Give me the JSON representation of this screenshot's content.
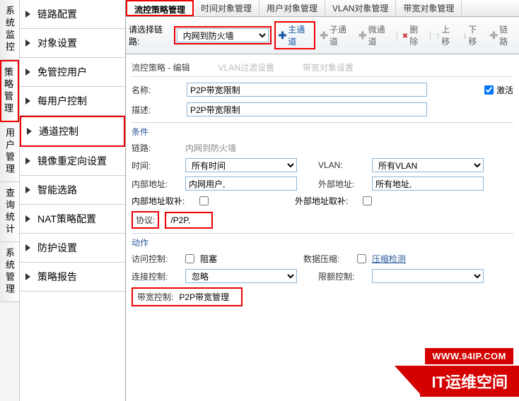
{
  "vtabs": [
    "系统监控",
    "策略管理",
    "用户管理",
    "查询统计",
    "系统管理"
  ],
  "sidebar": {
    "items": [
      {
        "label": "链路配置"
      },
      {
        "label": "对象设置"
      },
      {
        "label": "免管控用户"
      },
      {
        "label": "每用户控制"
      },
      {
        "label": "通道控制"
      },
      {
        "label": "镜像重定向设置"
      },
      {
        "label": "智能选路"
      },
      {
        "label": "NAT策略配置"
      },
      {
        "label": "防护设置"
      },
      {
        "label": "策略报告"
      }
    ]
  },
  "tabs": [
    "流控策略管理",
    "时间对象管理",
    "用户对象管理",
    "VLAN对象管理",
    "带宽对象管理"
  ],
  "toolbar": {
    "select_link_label": "请选择链路:",
    "link_value": "内网到防火墙",
    "main_channel": "主通道",
    "sub_channel": "子通道",
    "micro_channel": "微通道",
    "delete": "删除",
    "up": "上移",
    "down": "下移",
    "link": "链路"
  },
  "crumb": {
    "main": "流控策略 - 编辑",
    "g1": "VLAN过滤设置",
    "g2": "带宽对象设置"
  },
  "form": {
    "name_label": "名称:",
    "name_value": "P2P带宽限制",
    "activate": "激活",
    "desc_label": "描述:",
    "desc_value": "P2P带宽限制",
    "cond_title": "条件",
    "link_label": "链路:",
    "link_display": "内网到防火墙",
    "time_label": "时间:",
    "time_value": "所有时间",
    "vlan_label": "VLAN:",
    "vlan_value": "所有VLAN",
    "inner_addr_label": "内部地址:",
    "inner_addr_value": "内网用户,",
    "outer_addr_label": "外部地址:",
    "outer_addr_value": "所有地址,",
    "inner_addr_inv": "内部地址取补:",
    "outer_addr_inv": "外部地址取补:",
    "proto_label": "协议:",
    "proto_value": "/P2P,",
    "action_title": "动作",
    "access_ctrl": "访问控制:",
    "block": "阻塞",
    "data_compress": "数据压缩:",
    "compress_detect": "压缩检测",
    "conn_ctrl": "连接控制:",
    "ignore": "忽略",
    "quota_ctrl": "限额控制:",
    "bw_ctrl": "带宽控制:",
    "bw_value": "P2P带宽管理"
  },
  "watermark": {
    "url": "WWW.94IP.COM",
    "brand": "IT运维空间"
  }
}
